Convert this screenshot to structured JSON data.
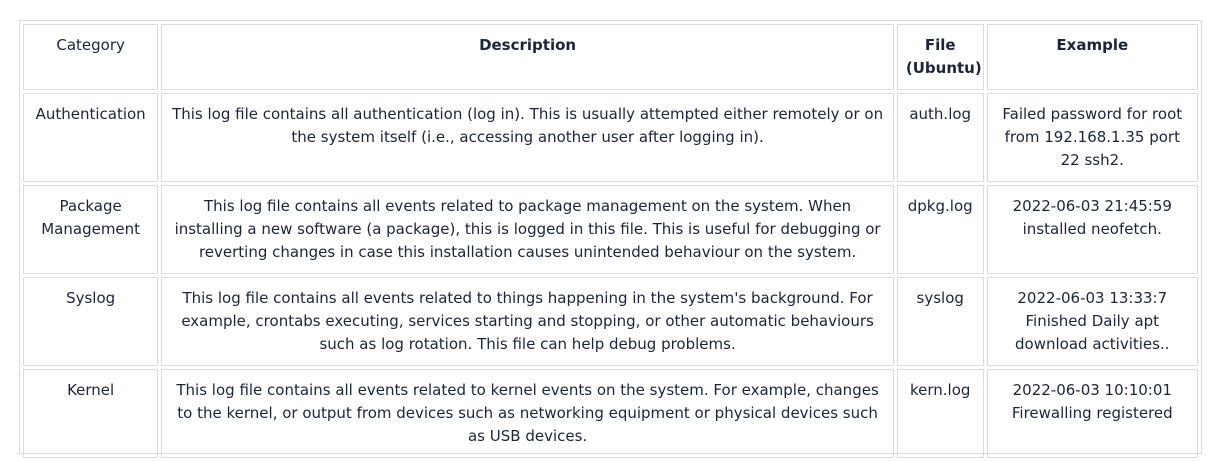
{
  "table": {
    "headers": [
      "Category",
      "Description",
      "File (Ubuntu)",
      "Example"
    ],
    "rows": [
      {
        "category": "Authentication",
        "description": "This log file contains all authentication (log in). This is usually attempted either remotely or on the system itself (i.e., accessing another user after logging in).",
        "file": "auth.log",
        "example": "Failed password for root from 192.168.1.35 port 22 ssh2."
      },
      {
        "category": "Package Management",
        "description": "This log file contains all events related to package management on the system. When installing a new software (a package), this is logged in this file. This is useful for debugging or reverting changes in case this installation causes unintended behaviour on the system.",
        "file": "dpkg.log",
        "example": "2022-06-03 21:45:59 installed neofetch."
      },
      {
        "category": "Syslog",
        "description": "This log file contains all events related to things happening in the system's background. For example, crontabs executing, services starting and stopping, or other automatic behaviours such as log rotation. This file can help debug problems.",
        "file": "syslog",
        "example": "2022-06-03 13:33:7 Finished Daily apt download activities.."
      },
      {
        "category": "Kernel",
        "description": "This log file contains all events related to kernel events on the system. For example, changes to the kernel, or output from devices such as networking equipment or physical devices such as USB devices.",
        "file": "kern.log",
        "example": "2022-06-03 10:10:01 Firewalling registered"
      }
    ]
  }
}
